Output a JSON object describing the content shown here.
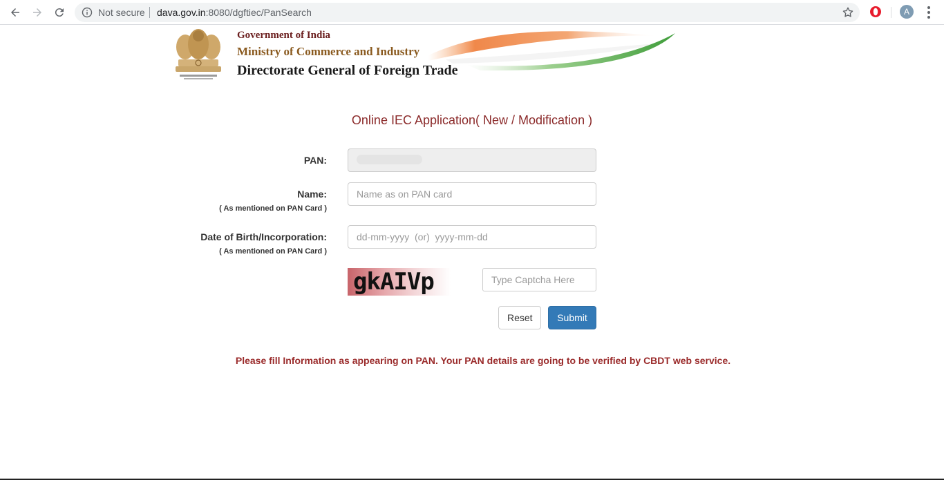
{
  "browser": {
    "security_label": "Not secure",
    "url_host": "dava.gov.in",
    "url_rest": ":8080/dgftiec/PanSearch",
    "profile_initial": "A"
  },
  "header": {
    "line1": "Government of India",
    "line2": "Ministry of Commerce and Industry",
    "line3": "Directorate General of Foreign Trade"
  },
  "form": {
    "title": "Online IEC Application( New / Modification )",
    "pan_label": "PAN:",
    "name_label": "Name:",
    "name_sub": "( As mentioned on PAN Card )",
    "name_placeholder": "Name as on PAN card",
    "dob_label": "Date of Birth/Incorporation:",
    "dob_sub": "( As mentioned on PAN Card )",
    "dob_placeholder": "dd-mm-yyyy  (or)  yyyy-mm-dd",
    "captcha_text": "gkAIVp",
    "captcha_placeholder": "Type Captcha Here",
    "reset_label": "Reset",
    "submit_label": "Submit"
  },
  "notice": "Please fill Information as appearing on PAN. Your PAN details are going to be verified by CBDT web service.",
  "colors": {
    "title": "#8b2a2a",
    "submit": "#337ab7",
    "notice": "#9a2a2a"
  }
}
